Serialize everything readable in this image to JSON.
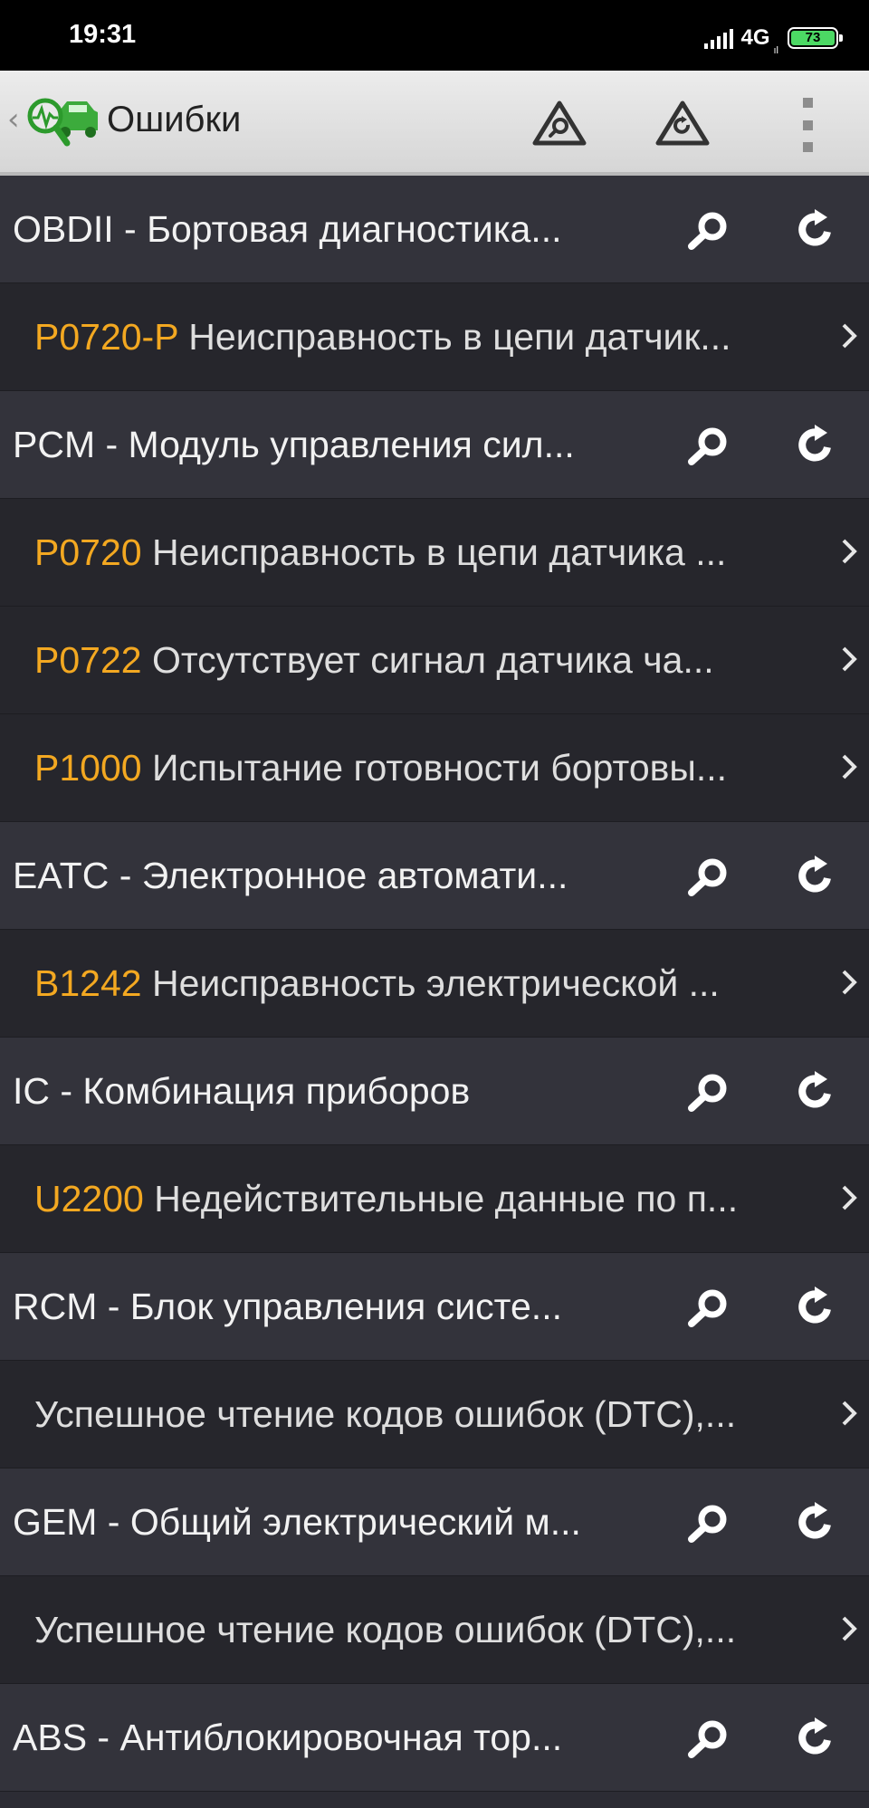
{
  "status_bar": {
    "time": "19:31",
    "network": "4G",
    "network_sub": "ıl",
    "battery": "73"
  },
  "app_bar": {
    "title": "Ошибки",
    "back_icon": "chevron-left-icon",
    "logo_icon": "car-diagnostic-logo-icon",
    "action1_icon": "warning-triangle-search-icon",
    "action2_icon": "warning-triangle-refresh-icon",
    "overflow_icon": "more-vertical-icon"
  },
  "colors": {
    "code": "#f3a821",
    "module_row_bg": "#33333b",
    "dtc_row_bg": "#26262c"
  },
  "rows": [
    {
      "type": "module",
      "text": "OBDII - Бортовая диагностика..."
    },
    {
      "type": "dtc",
      "code": "P0720-P",
      "text": " Неисправность в цепи датчик..."
    },
    {
      "type": "module",
      "text": "PCM - Модуль управления сил..."
    },
    {
      "type": "dtc",
      "code": "P0720",
      "text": " Неисправность в цепи датчика ..."
    },
    {
      "type": "dtc",
      "code": "P0722",
      "text": " Отсутствует сигнал  датчика ча..."
    },
    {
      "type": "dtc",
      "code": "P1000",
      "text": " Испытание готовности бортовы..."
    },
    {
      "type": "module",
      "text": "EATC - Электронное автомати..."
    },
    {
      "type": "dtc",
      "code": "B1242",
      "text": " Неисправность электрической ..."
    },
    {
      "type": "module",
      "text": "IC - Комбинация приборов"
    },
    {
      "type": "dtc",
      "code": "U2200",
      "text": " Недействительные данные по п..."
    },
    {
      "type": "module",
      "text": "RCM - Блок управления систе..."
    },
    {
      "type": "dtc",
      "code": "",
      "text": "Успешное чтение кодов ошибок (DTC),..."
    },
    {
      "type": "module",
      "text": "GEM - Общий электрический м..."
    },
    {
      "type": "dtc",
      "code": "",
      "text": "Успешное чтение кодов ошибок (DTC),..."
    },
    {
      "type": "module",
      "text": "ABS - Антиблокировочная тор..."
    }
  ]
}
